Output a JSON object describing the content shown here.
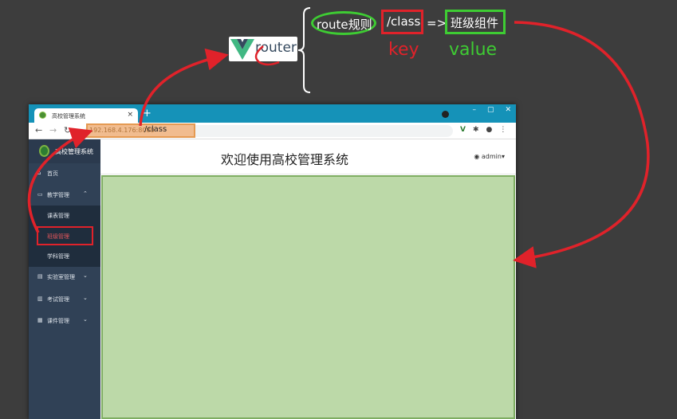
{
  "annotation": {
    "logo_text": "router",
    "route_rule": "route规则",
    "path": "/class",
    "arrow": "=>",
    "component": "班级组件",
    "key_label": "key",
    "value_label": "value",
    "colors": {
      "red": "#e0222a",
      "green": "#3ecc33"
    }
  },
  "browser": {
    "tab_title": "高校管理系统",
    "tab_close": "×",
    "new_tab": "+",
    "url_host": "192.168.4.176:8080",
    "url_path": "/class",
    "window_buttons": [
      "–",
      "▢",
      "✕"
    ]
  },
  "app": {
    "brand": "高校管理系统",
    "header_title": "欢迎使用高校管理系统",
    "user": "admin",
    "sidebar": [
      {
        "label": "首页",
        "icon": "home-icon"
      },
      {
        "label": "教学管理",
        "icon": "monitor-icon",
        "chevron": "⌃"
      },
      {
        "label": "课表管理",
        "sub": true
      },
      {
        "label": "班级管理",
        "sub": true,
        "active": true
      },
      {
        "label": "学科管理",
        "sub": true
      },
      {
        "label": "实验室管理",
        "icon": "doc-icon",
        "chevron": "⌄"
      },
      {
        "label": "考试管理",
        "icon": "book-icon",
        "chevron": "⌄"
      },
      {
        "label": "课件管理",
        "icon": "file-icon",
        "chevron": "⌄"
      }
    ]
  }
}
